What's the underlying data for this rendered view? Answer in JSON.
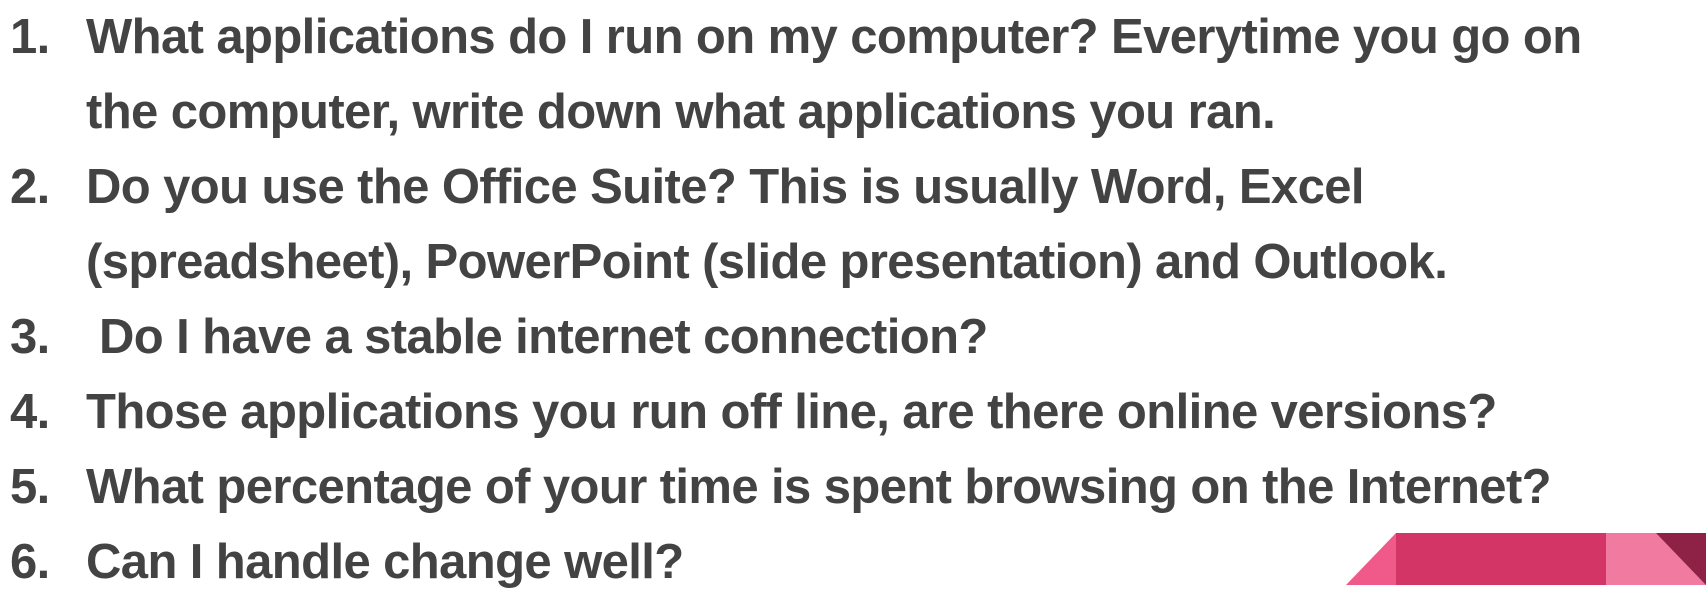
{
  "items": [
    {
      "number": "1.",
      "line1": "What applications do I run on my computer?  Everytime you go on",
      "line2": "the computer, write down what applications you ran."
    },
    {
      "number": "2.",
      "line1": "Do you use the Office Suite?  This is usually Word, Excel",
      "line2": "(spreadsheet), PowerPoint (slide presentation) and Outlook."
    },
    {
      "number": "3.",
      "line1": " Do I have a stable internet connection?"
    },
    {
      "number": "4.",
      "line1": "Those applications you run off line, are there online versions?"
    },
    {
      "number": "5.",
      "line1": "What percentage of your time is spent browsing on the Internet?"
    },
    {
      "number": "6.",
      "line1": "Can I handle change well?"
    }
  ],
  "colors": {
    "text": "#434343",
    "ribbon_light": "#ef5a8a",
    "ribbon_main": "#d33567",
    "ribbon_dark": "#8e2246",
    "ribbon_fold": "#f07aa0"
  }
}
